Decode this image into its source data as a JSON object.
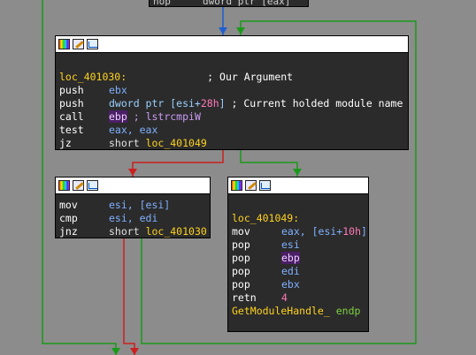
{
  "top_fragment": {
    "mnemonic": "nop",
    "operand": "dword ptr [eax]"
  },
  "node1": {
    "label": "loc_401030:",
    "label_comment": "; Our Argument",
    "lines": [
      {
        "mn": "push",
        "op": "ebx"
      },
      {
        "mn": "push",
        "op_prefix": "dword ptr [esi+",
        "op_imm": "28h",
        "op_suffix": "]",
        "comment": "; Current holded module name"
      },
      {
        "mn": "call",
        "op_hl": "ebp",
        "op_sym": "; lstrcmpiW"
      },
      {
        "mn": "test",
        "op": "eax, eax"
      },
      {
        "mn": "jz",
        "op_kw": "short",
        "op_label": "loc_401049"
      }
    ]
  },
  "node2": {
    "lines": [
      {
        "mn": "mov",
        "op": "esi, [esi]"
      },
      {
        "mn": "cmp",
        "op": "esi, edi"
      },
      {
        "mn": "jnz",
        "op_kw": "short",
        "op_label": "loc_401030"
      }
    ]
  },
  "node3": {
    "label": "loc_401049:",
    "lines": [
      {
        "mn": "mov",
        "op_prefix": "eax, [esi+",
        "op_imm": "10h",
        "op_suffix": "]"
      },
      {
        "mn": "pop",
        "op": "esi"
      },
      {
        "mn": "pop",
        "op_hl": "ebp"
      },
      {
        "mn": "pop",
        "op": "edi"
      },
      {
        "mn": "pop",
        "op": "ebx"
      },
      {
        "mn": "retn",
        "op_imm": "4"
      }
    ],
    "endp_func": "GetModuleHandle_",
    "endp_kw": "endp"
  },
  "colors": {
    "background": "#8c8c8c",
    "node_bg": "#2b2b2b",
    "edge_true": "#1a9a1a",
    "edge_false": "#cc1f1f",
    "edge_uncond": "#1f5fd0",
    "label": "#ffd21e"
  },
  "icons": [
    "color-palette-icon",
    "edit-pen-icon",
    "graph-view-icon"
  ]
}
